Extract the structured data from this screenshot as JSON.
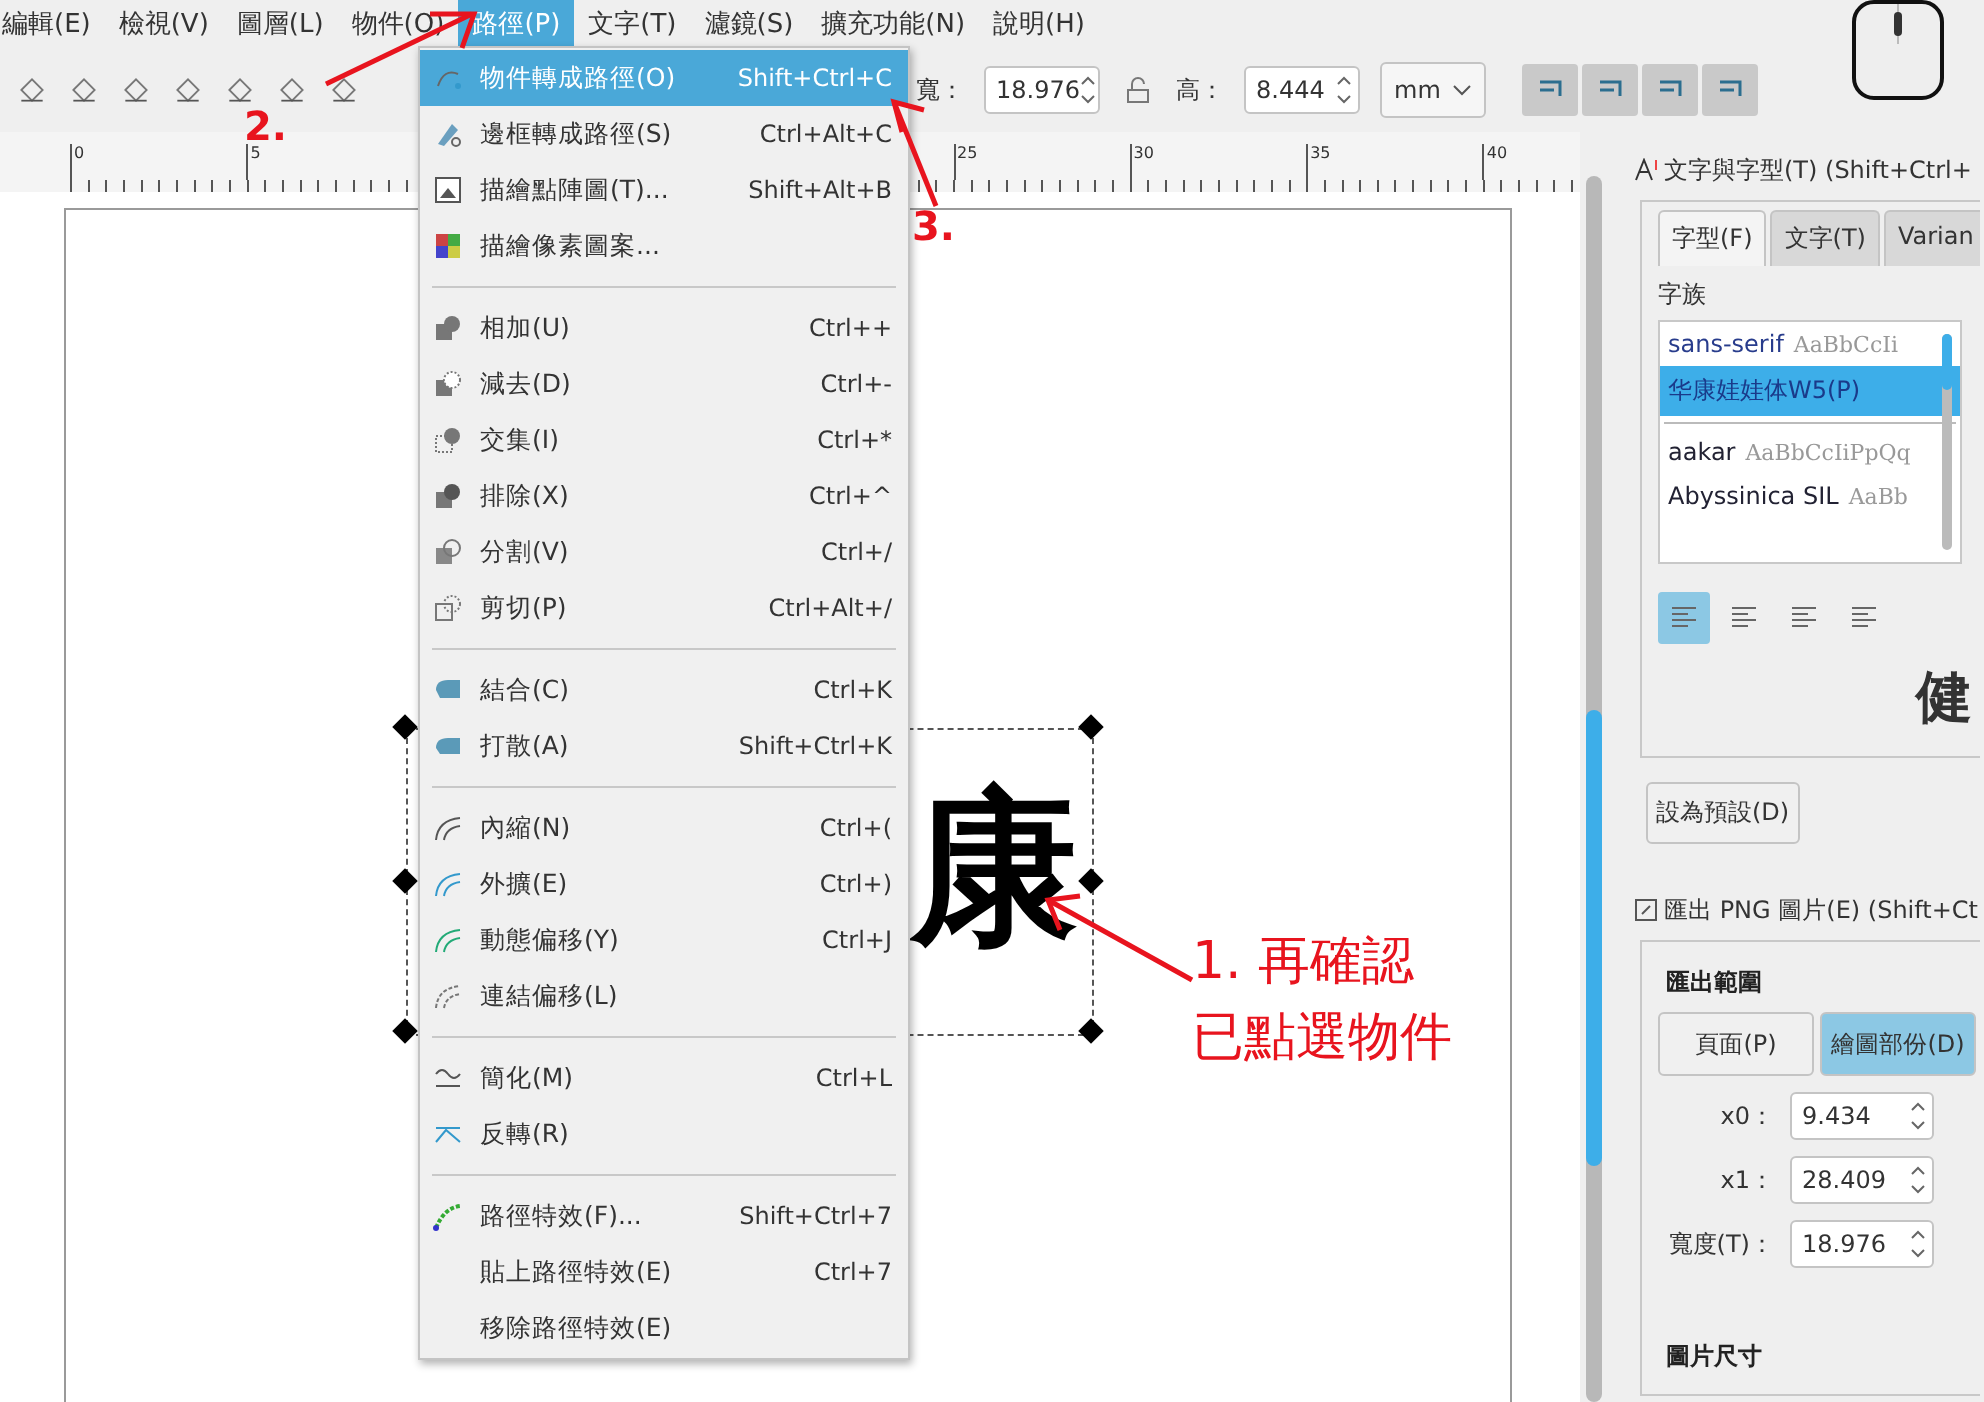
{
  "menubar": {
    "items": [
      {
        "label": "編輯(E)",
        "selected": false
      },
      {
        "label": "檢視(V)",
        "selected": false
      },
      {
        "label": "圖層(L)",
        "selected": false
      },
      {
        "label": "物件(O)",
        "selected": false
      },
      {
        "label": "路徑(P)",
        "selected": true
      },
      {
        "label": "文字(T)",
        "selected": false
      },
      {
        "label": "濾鏡(S)",
        "selected": false
      },
      {
        "label": "擴充功能(N)",
        "selected": false
      },
      {
        "label": "說明(H)",
        "selected": false
      }
    ]
  },
  "toolbar": {
    "width_label": "寬：",
    "width_value": "18.976",
    "height_label": "高：",
    "height_value": "8.444",
    "unit": "mm"
  },
  "ruler": {
    "labels": [
      "0",
      "5",
      "25",
      "30",
      "35",
      "40"
    ]
  },
  "canvas": {
    "glyph": "康",
    "annotations": {
      "step_2": "2.",
      "step_3": "3.",
      "step_1_lines": [
        "1.  再確認",
        "已點選物件"
      ]
    }
  },
  "path_menu": {
    "items": [
      {
        "kind": "item",
        "label": "物件轉成路徑(O)",
        "shortcut": "Shift+Ctrl+C",
        "selected": true
      },
      {
        "kind": "item",
        "label": "邊框轉成路徑(S)",
        "shortcut": "Ctrl+Alt+C",
        "selected": false
      },
      {
        "kind": "item",
        "label": "描繪點陣圖(T)...",
        "shortcut": "Shift+Alt+B",
        "selected": false
      },
      {
        "kind": "item",
        "label": "描繪像素圖案...",
        "selected": false
      },
      {
        "kind": "separator"
      },
      {
        "kind": "item",
        "label": "相加(U)",
        "shortcut": "Ctrl++",
        "selected": false
      },
      {
        "kind": "item",
        "label": "減去(D)",
        "shortcut": "Ctrl+-",
        "selected": false
      },
      {
        "kind": "item",
        "label": "交集(I)",
        "shortcut": "Ctrl+*",
        "selected": false
      },
      {
        "kind": "item",
        "label": "排除(X)",
        "shortcut": "Ctrl+^",
        "selected": false
      },
      {
        "kind": "item",
        "label": "分割(V)",
        "shortcut": "Ctrl+/",
        "selected": false
      },
      {
        "kind": "item",
        "label": "剪切(P)",
        "shortcut": "Ctrl+Alt+/",
        "selected": false
      },
      {
        "kind": "separator"
      },
      {
        "kind": "item",
        "label": "結合(C)",
        "shortcut": "Ctrl+K",
        "selected": false
      },
      {
        "kind": "item",
        "label": "打散(A)",
        "shortcut": "Shift+Ctrl+K",
        "selected": false
      },
      {
        "kind": "separator"
      },
      {
        "kind": "item",
        "label": "內縮(N)",
        "shortcut": "Ctrl+(",
        "selected": false
      },
      {
        "kind": "item",
        "label": "外擴(E)",
        "shortcut": "Ctrl+)",
        "selected": false
      },
      {
        "kind": "item",
        "label": "動態偏移(Y)",
        "shortcut": "Ctrl+J",
        "selected": false
      },
      {
        "kind": "item",
        "label": "連結偏移(L)",
        "selected": false
      },
      {
        "kind": "separator"
      },
      {
        "kind": "item",
        "label": "簡化(M)",
        "shortcut": "Ctrl+L",
        "selected": false
      },
      {
        "kind": "item",
        "label": "反轉(R)",
        "selected": false
      },
      {
        "kind": "separator"
      },
      {
        "kind": "item",
        "label": "路徑特效(F)...",
        "shortcut": "Shift+Ctrl+7",
        "selected": false
      },
      {
        "kind": "item",
        "label": "貼上路徑特效(E)",
        "shortcut": "Ctrl+7",
        "selected": false
      },
      {
        "kind": "item",
        "label": "移除路徑特效(E)",
        "selected": false
      }
    ]
  },
  "text_panel": {
    "title": "文字與字型(T) (Shift+Ctrl+",
    "tabs": [
      {
        "label": "字型(F)",
        "selected": true
      },
      {
        "label": "文字(T)",
        "selected": false
      },
      {
        "label": "Varian",
        "selected": false
      }
    ],
    "family_label": "字族",
    "fonts": [
      {
        "name": "sans-serif",
        "sample": "AaBbCcIi",
        "selected": false
      },
      {
        "name": "华康娃娃体W5(P)",
        "selected": true
      },
      {
        "name": "aakar",
        "sample": "AaBbCcIiPpQq",
        "selected": false
      },
      {
        "name": "Abyssinica SIL",
        "sample": "AaBb",
        "selected": false
      }
    ],
    "align": [
      {
        "selected": true
      },
      {
        "selected": false
      },
      {
        "selected": false
      },
      {
        "selected": false
      }
    ],
    "preview": "健",
    "default_button": "設為預設(D)"
  },
  "export_panel": {
    "title": "匯出 PNG 圖片(E) (Shift+Ct",
    "area_label": "匯出範圍",
    "area_buttons": [
      {
        "label": "頁面(P)",
        "selected": false
      },
      {
        "label": "繪圖部份(D)",
        "selected": true
      }
    ],
    "fields": [
      {
        "label": "x0：",
        "value": "9.434"
      },
      {
        "label": "x1：",
        "value": "28.409"
      },
      {
        "label": "寬度(T)：",
        "value": "18.976"
      }
    ],
    "size_label": "圖片尺寸"
  }
}
